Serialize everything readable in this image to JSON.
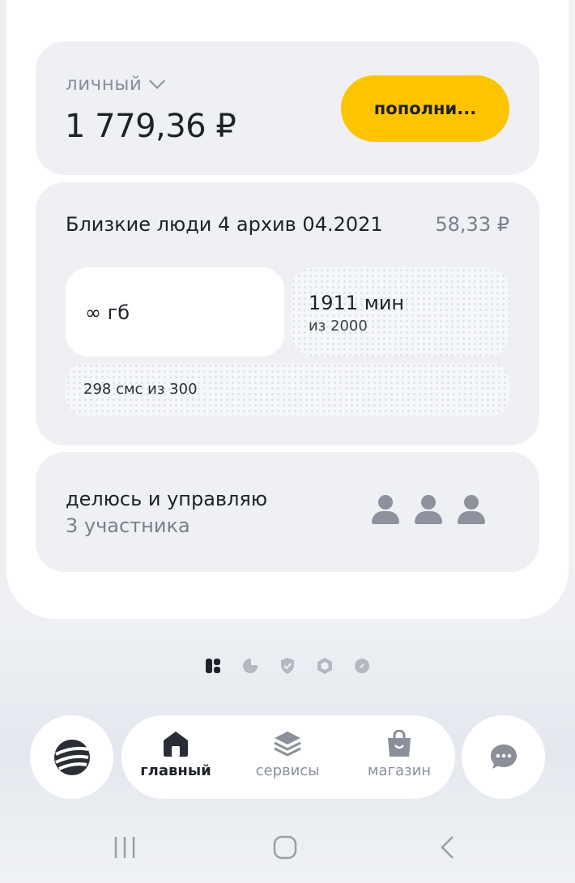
{
  "account": {
    "label": "личный",
    "balance": "1 779,36 ₽",
    "topup_label": "пополни..."
  },
  "tariff": {
    "name": "Близкие люди 4 архив 04.2021",
    "price": "58,33 ₽",
    "internet": "∞ гб",
    "minutes_value": "1911 мин",
    "minutes_total": "из 2000",
    "sms": "298 смс из 300"
  },
  "sharing": {
    "title": "делюсь и управляю",
    "subtitle": "3 участника",
    "participants_icons": [
      "person-icon",
      "person-icon",
      "person-icon"
    ]
  },
  "page_dots": [
    "cards-icon",
    "pie-chart-icon",
    "shield-check-icon",
    "hexagon-icon",
    "compass-icon"
  ],
  "bottom_nav": {
    "items": [
      {
        "label": "главный",
        "icon": "home-icon",
        "active": true
      },
      {
        "label": "сервисы",
        "icon": "layers-icon",
        "active": false
      },
      {
        "label": "магазин",
        "icon": "shopping-bag-icon",
        "active": false
      }
    ]
  },
  "colors": {
    "accent": "#fdc400",
    "panel": "#eef0f4",
    "text_primary": "#1f2229",
    "text_secondary": "#7a7f8a"
  }
}
